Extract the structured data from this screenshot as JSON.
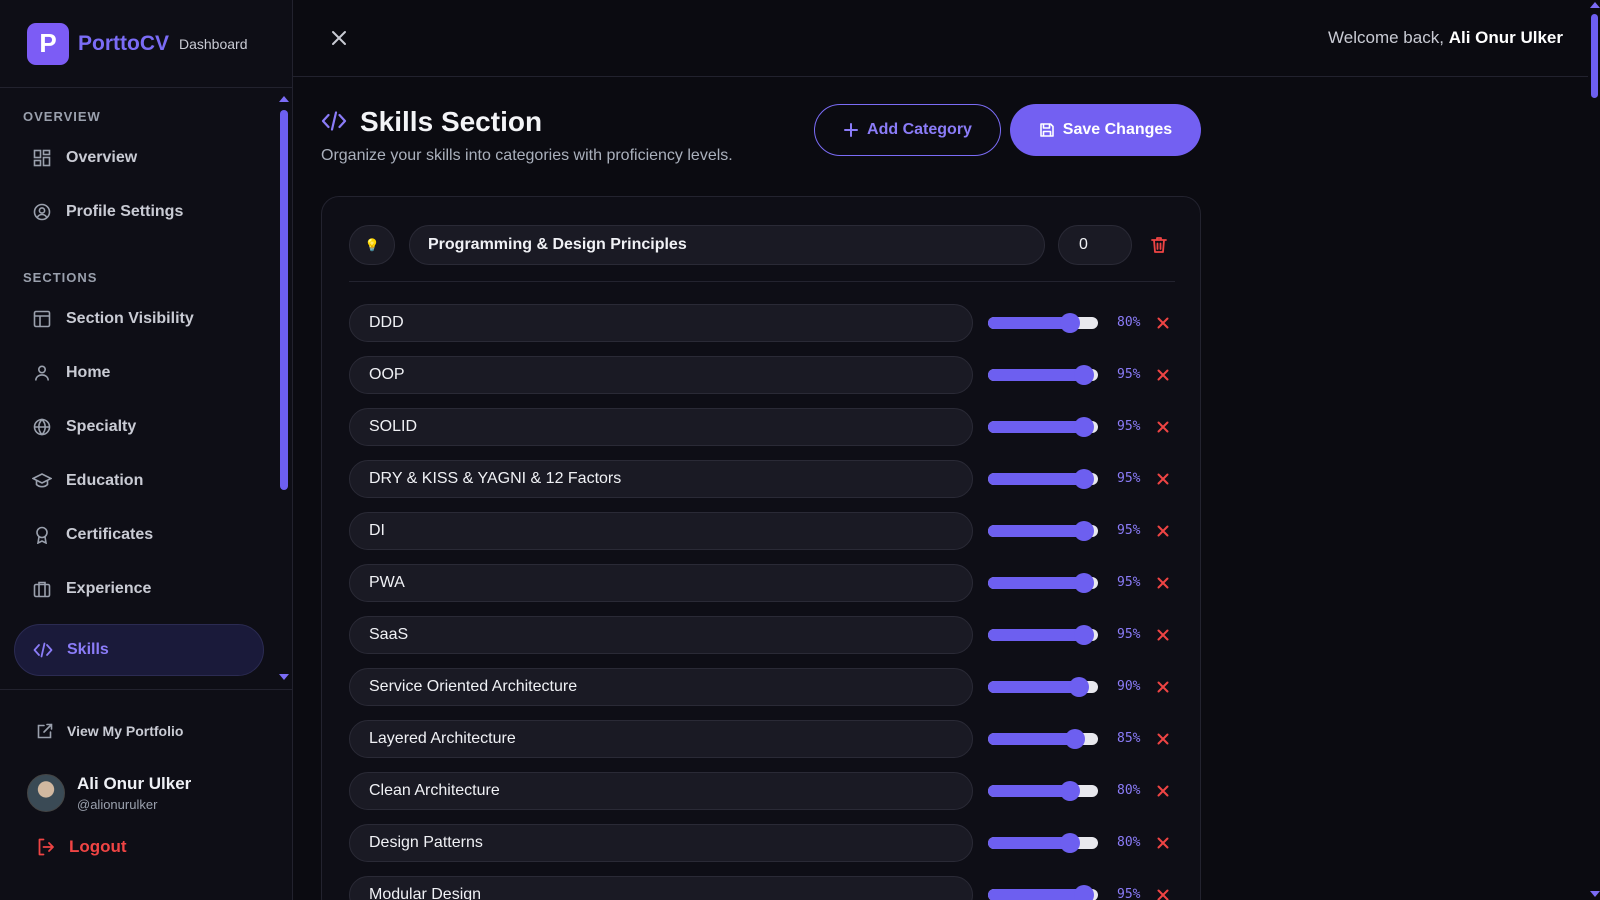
{
  "brand": {
    "logo_letter": "P",
    "name": "PorttoCV",
    "tag": "Dashboard"
  },
  "nav": {
    "overview_heading": "OVERVIEW",
    "sections_heading": "SECTIONS",
    "items": [
      {
        "label": "Overview",
        "icon": "grid-icon"
      },
      {
        "label": "Profile Settings",
        "icon": "user-circle-icon"
      },
      {
        "label": "Section Visibility",
        "icon": "layout-icon"
      },
      {
        "label": "Home",
        "icon": "user-icon"
      },
      {
        "label": "Specialty",
        "icon": "globe-icon"
      },
      {
        "label": "Education",
        "icon": "graduation-cap-icon"
      },
      {
        "label": "Certificates",
        "icon": "award-icon"
      },
      {
        "label": "Experience",
        "icon": "briefcase-icon"
      },
      {
        "label": "Skills",
        "icon": "code-icon",
        "active": true
      }
    ]
  },
  "sidebar_bottom": {
    "portfolio_link": "View My Portfolio",
    "user_name": "Ali Onur Ulker",
    "user_handle": "@alionurulker",
    "logout": "Logout"
  },
  "topbar": {
    "welcome_prefix": "Welcome back,",
    "welcome_name": "Ali Onur Ulker"
  },
  "page": {
    "title": "Skills Section",
    "subtitle": "Organize your skills into categories with proficiency levels.",
    "add_category": "Add Category",
    "save_changes": "Save Changes"
  },
  "category": {
    "icon_value": "💡",
    "name": "Programming & Design Principles",
    "order": "0",
    "skills": [
      {
        "name": "DDD",
        "level": 80,
        "pct": "80%"
      },
      {
        "name": "OOP",
        "level": 95,
        "pct": "95%"
      },
      {
        "name": "SOLID",
        "level": 95,
        "pct": "95%"
      },
      {
        "name": "DRY & KISS & YAGNI & 12 Factors",
        "level": 95,
        "pct": "95%"
      },
      {
        "name": "DI",
        "level": 95,
        "pct": "95%"
      },
      {
        "name": "PWA",
        "level": 95,
        "pct": "95%"
      },
      {
        "name": "SaaS",
        "level": 95,
        "pct": "95%"
      },
      {
        "name": "Service Oriented Architecture",
        "level": 90,
        "pct": "90%"
      },
      {
        "name": "Layered Architecture",
        "level": 85,
        "pct": "85%"
      },
      {
        "name": "Clean Architecture",
        "level": 80,
        "pct": "80%"
      },
      {
        "name": "Design Patterns",
        "level": 80,
        "pct": "80%"
      },
      {
        "name": "Modular Design",
        "level": 95,
        "pct": "95%"
      }
    ]
  },
  "colors": {
    "accent": "#7360f2",
    "danger": "#ef4444",
    "background": "#0b0b11"
  }
}
